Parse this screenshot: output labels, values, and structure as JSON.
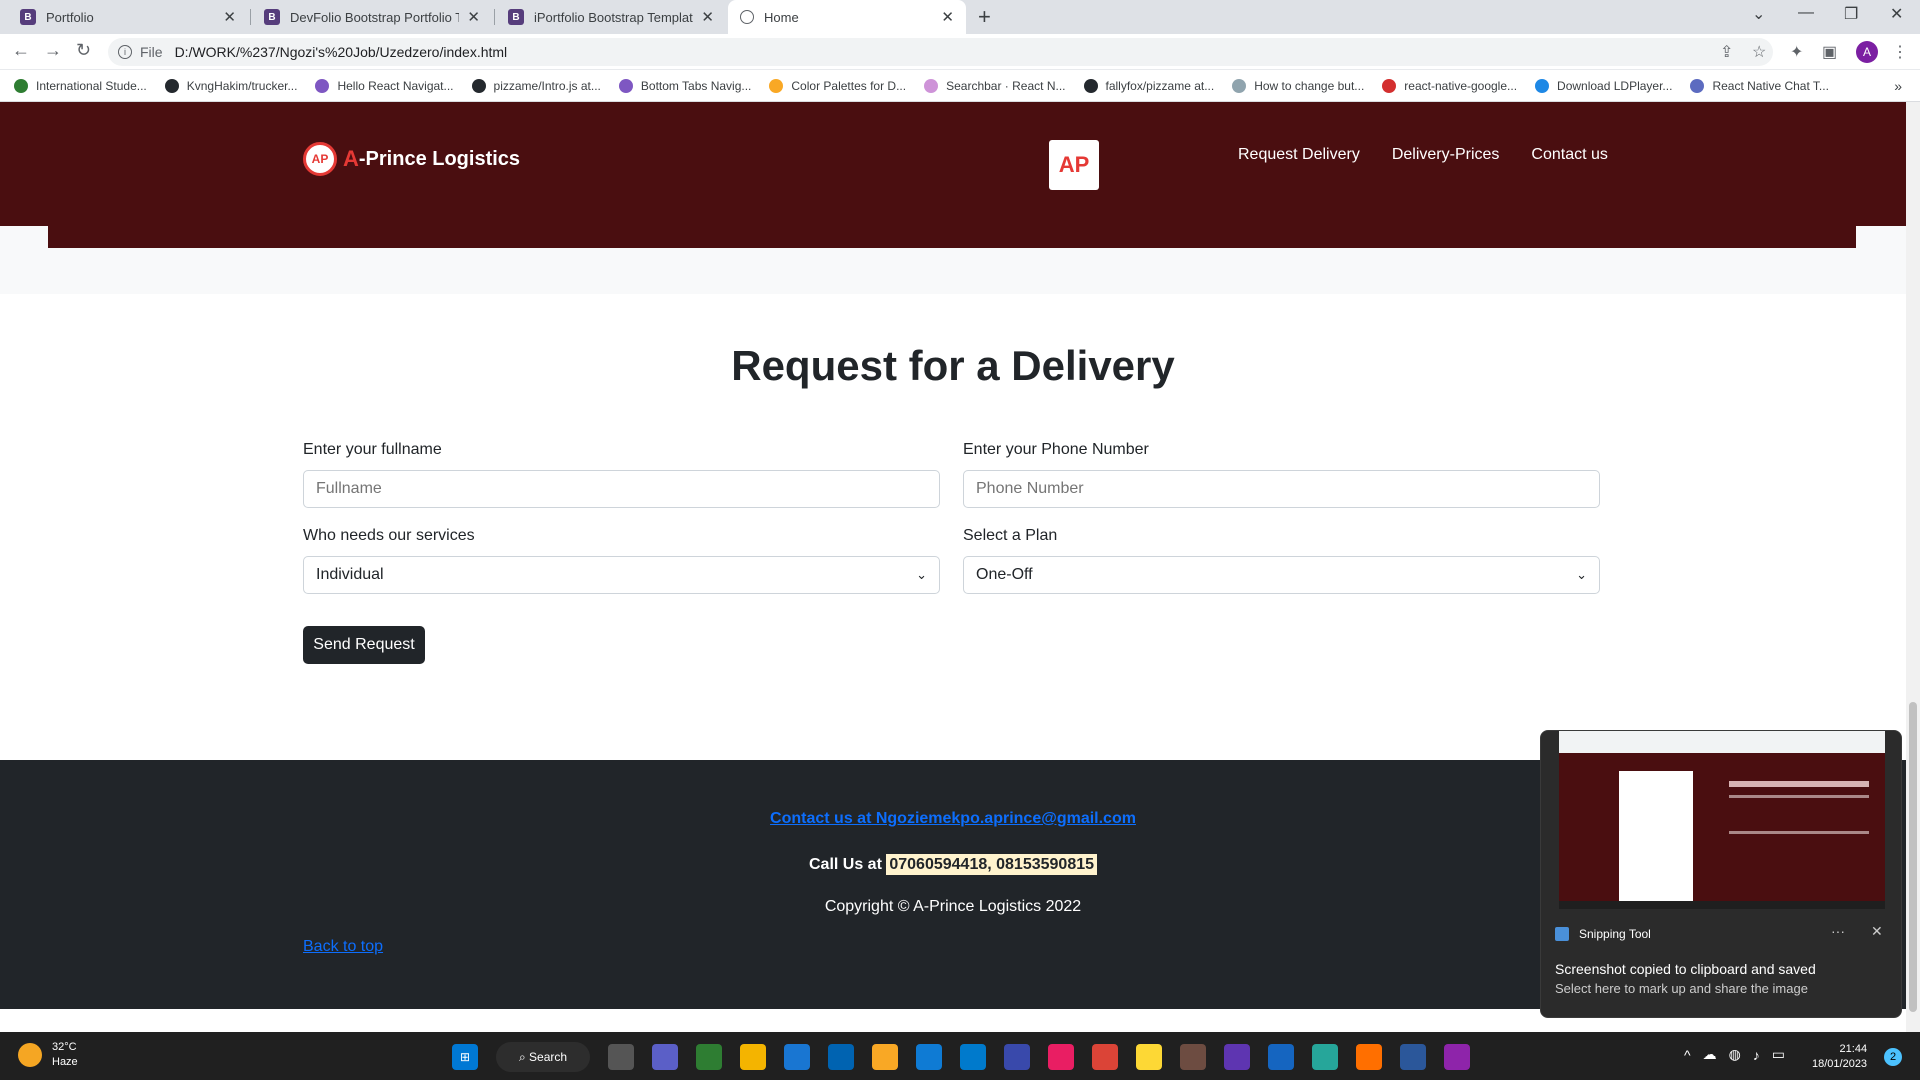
{
  "browser": {
    "tabs": [
      {
        "title": "Portfolio",
        "icon": "bootstrap-icon",
        "close": "✕"
      },
      {
        "title": "DevFolio Bootstrap Portfolio Tem",
        "icon": "bootstrap-icon",
        "close": "✕"
      },
      {
        "title": "iPortfolio Bootstrap Template - Ir",
        "icon": "bootstrap-icon",
        "close": "✕"
      },
      {
        "title": "Home",
        "icon": "globe-icon",
        "close": "✕"
      }
    ],
    "new_tab": "+",
    "window_controls": [
      "⌄",
      "—",
      "❐",
      "✕"
    ],
    "nav": {
      "back": "←",
      "forward": "→",
      "reload": "↻"
    },
    "address": {
      "scheme": "File",
      "url": "D:/WORK/%237/Ngozi's%20Job/Uzedzero/index.html",
      "info_glyph": "i"
    },
    "profile_initial": "A",
    "bookmarks": [
      {
        "label": "International Stude...",
        "color": "#2e7d32"
      },
      {
        "label": "KvngHakim/trucker...",
        "color": "#24292e"
      },
      {
        "label": "Hello React Navigat...",
        "color": "#7e57c2"
      },
      {
        "label": "pizzame/Intro.js at...",
        "color": "#24292e"
      },
      {
        "label": "Bottom Tabs Navig...",
        "color": "#7e57c2"
      },
      {
        "label": "Color Palettes for D...",
        "color": "#f9a825"
      },
      {
        "label": "Searchbar · React N...",
        "color": "#ce93d8"
      },
      {
        "label": "fallyfox/pizzame at...",
        "color": "#24292e"
      },
      {
        "label": "How to change but...",
        "color": "#90a4ae"
      },
      {
        "label": "react-native-google...",
        "color": "#d32f2f"
      },
      {
        "label": "Download LDPlayer...",
        "color": "#1e88e5"
      },
      {
        "label": "React Native Chat T...",
        "color": "#5c6bc0"
      }
    ],
    "bookmarks_more": "»"
  },
  "site": {
    "brand_a": "A",
    "brand_rest": "-Prince Logistics",
    "logo_glyph": "AP",
    "nav": [
      "Request Delivery",
      "Delivery-Prices",
      "Contact us"
    ],
    "colors": {
      "hero": "#4a0e10",
      "accent": "#e53935",
      "footer": "#212529",
      "link": "#0d6efd"
    }
  },
  "form": {
    "title": "Request for a Delivery",
    "fullname_label": "Enter your fullname",
    "fullname_placeholder": "Fullname",
    "phone_label": "Enter your Phone Number",
    "phone_placeholder": "Phone Number",
    "who_label": "Who needs our services",
    "who_value": "Individual",
    "plan_label": "Select a Plan",
    "plan_value": "One-Off",
    "submit": "Send Request"
  },
  "footer": {
    "contact": "Contact us at Ngoziemekpo.aprince@gmail.com",
    "call_prefix": "Call Us at",
    "call_numbers": "07060594418, 08153590815",
    "copyright": "Copyright © A-Prince Logistics 2022",
    "back_to_top": "Back to top"
  },
  "toast": {
    "app": "Snipping Tool",
    "more": "···",
    "close": "✕",
    "headline": "Screenshot copied to clipboard and saved",
    "subline": "Select here to mark up and share the image"
  },
  "taskbar": {
    "temperature": "32°C",
    "condition": "Haze",
    "search": "Search",
    "time": "21:44",
    "date": "18/01/2023",
    "notifications": "2",
    "tray_more": "^"
  }
}
